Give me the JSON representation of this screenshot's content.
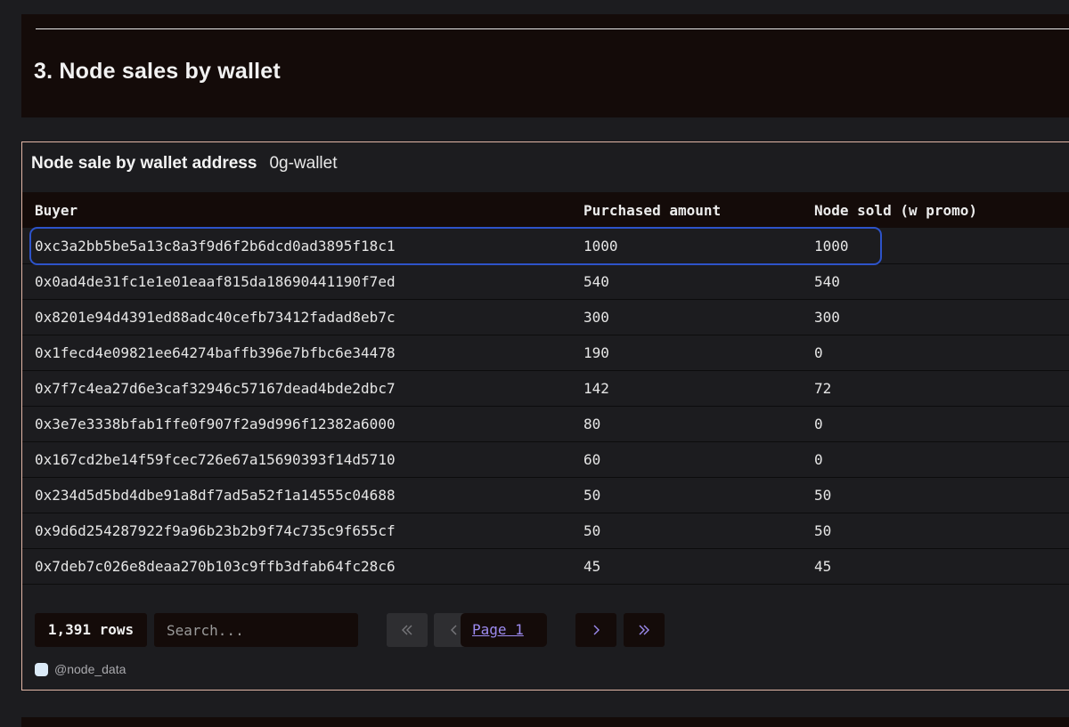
{
  "section": {
    "title": "3. Node sales by wallet"
  },
  "panel": {
    "title": "Node sale by wallet address",
    "subtitle": "0g-wallet",
    "columns": {
      "buyer": "Buyer",
      "amount": "Purchased amount",
      "sold": "Node sold (w promo)"
    },
    "rows": [
      {
        "buyer": "0xc3a2bb5be5a13c8a3f9d6f2b6dcd0ad3895f18c1",
        "amount": "1000",
        "sold": "1000"
      },
      {
        "buyer": "0x0ad4de31fc1e1e01eaaf815da18690441190f7ed",
        "amount": "540",
        "sold": "540"
      },
      {
        "buyer": "0x8201e94d4391ed88adc40cefb73412fadad8eb7c",
        "amount": "300",
        "sold": "300"
      },
      {
        "buyer": "0x1fecd4e09821ee64274baffb396e7bfbc6e34478",
        "amount": "190",
        "sold": "0"
      },
      {
        "buyer": "0x7f7c4ea27d6e3caf32946c57167dead4bde2dbc7",
        "amount": "142",
        "sold": "72"
      },
      {
        "buyer": "0x3e7e3338bfab1ffe0f907f2a9d996f12382a6000",
        "amount": "80",
        "sold": "0"
      },
      {
        "buyer": "0x167cd2be14f59fcec726e67a15690393f14d5710",
        "amount": "60",
        "sold": "0"
      },
      {
        "buyer": "0x234d5d5bd4dbe91a8df7ad5a52f1a14555c04688",
        "amount": "50",
        "sold": "50"
      },
      {
        "buyer": "0x9d6d254287922f9a96b23b2b9f74c735c9f655cf",
        "amount": "50",
        "sold": "50"
      },
      {
        "buyer": "0x7deb7c026e8deaa270b103c9ffb3dfab64fc28c6",
        "amount": "45",
        "sold": "45"
      }
    ],
    "highlighted_row": 0,
    "footer": {
      "row_count": "1,391 rows",
      "search_placeholder": "Search...",
      "page_label": "Page 1"
    },
    "credit": "@node_data"
  },
  "icons": {
    "first_page": "double-chevron-left-icon",
    "prev_page": "chevron-left-icon",
    "next_page": "chevron-right-icon",
    "last_page": "double-chevron-right-icon",
    "credit_badge": "creator-badge-icon"
  },
  "colors": {
    "background": "#1c1c1f",
    "header_bg": "#140b09",
    "panel_border": "#e3b7a6",
    "highlight": "#2d53c9",
    "page_link": "#9d8bf0"
  }
}
